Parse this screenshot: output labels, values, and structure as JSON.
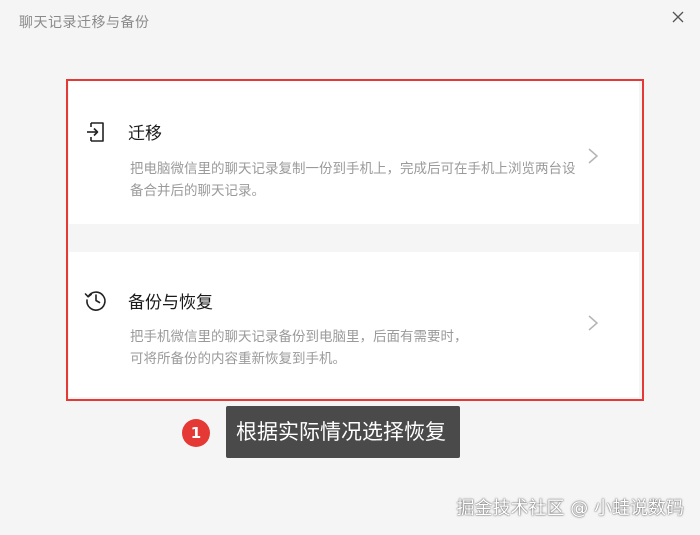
{
  "window": {
    "title": "聊天记录迁移与备份"
  },
  "options": [
    {
      "title": "迁移",
      "description": "把电脑微信里的聊天记录复制一份到手机上，完成后可在手机上浏览两台设备合并后的聊天记录。",
      "icon": "migrate-icon"
    },
    {
      "title": "备份与恢复",
      "description_line1": "把手机微信里的聊天记录备份到电脑里，后面有需要时，",
      "description_line2": "可将所备份的内容重新恢复到手机。",
      "icon": "history-icon"
    }
  ],
  "annotation": {
    "step_number": "1",
    "text": "根据实际情况选择恢复"
  },
  "watermark": "掘金技术社区 @ 小蛙说数码",
  "colors": {
    "highlight": "#e53935",
    "tooltip_bg": "#4a4a4a",
    "background": "#f5f5f5",
    "card": "#ffffff"
  }
}
